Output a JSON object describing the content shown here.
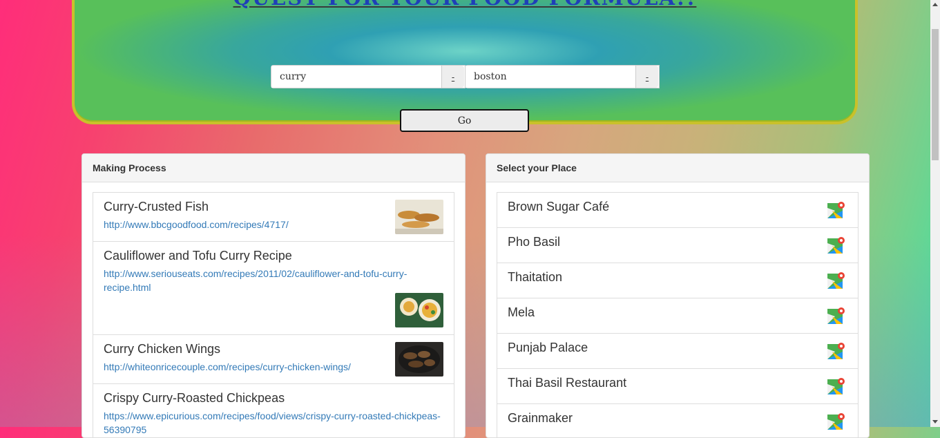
{
  "header": {
    "title": "QUEST FOR YOUR FOOD FORMULA!!",
    "food_input_value": "curry",
    "location_input_value": "boston",
    "addon_label": "-",
    "go_label": "Go"
  },
  "recipes_panel": {
    "heading": "Making Process",
    "items": [
      {
        "title": "Curry-Crusted Fish",
        "link": "http://www.bbcgoodfood.com/recipes/4717/"
      },
      {
        "title": "Cauliflower and Tofu Curry Recipe",
        "link": "http://www.seriouseats.com/recipes/2011/02/cauliflower-and-tofu-curry-recipe.html"
      },
      {
        "title": "Curry Chicken Wings",
        "link": "http://whiteonricecouple.com/recipes/curry-chicken-wings/"
      },
      {
        "title": "Crispy Curry-Roasted Chickpeas",
        "link": "https://www.epicurious.com/recipes/food/views/crispy-curry-roasted-chickpeas-56390795"
      }
    ]
  },
  "places_panel": {
    "heading": "Select your Place",
    "items": [
      {
        "name": "Brown Sugar Café"
      },
      {
        "name": "Pho Basil"
      },
      {
        "name": "Thaitation"
      },
      {
        "name": "Mela"
      },
      {
        "name": "Punjab Palace"
      },
      {
        "name": "Thai Basil Restaurant"
      },
      {
        "name": "Grainmaker"
      }
    ]
  },
  "icons": {
    "map": "google-maps-icon",
    "thumbnail": "recipe-photo"
  }
}
